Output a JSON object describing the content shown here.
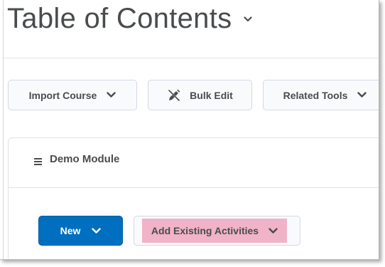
{
  "page": {
    "title": "Table of Contents"
  },
  "toolbar": {
    "import_course_label": "Import Course",
    "bulk_edit_label": "Bulk Edit",
    "related_tools_label": "Related Tools"
  },
  "module": {
    "title": "Demo Module",
    "actions": {
      "new_label": "New",
      "add_existing_label": "Add Existing Activities"
    }
  },
  "colors": {
    "primary_button": "#006fbf",
    "highlight": "#f0b3c8",
    "text": "#494c4e"
  },
  "icons": [
    "chevron-down-icon",
    "pencil-icon",
    "drag-handle-icon"
  ]
}
